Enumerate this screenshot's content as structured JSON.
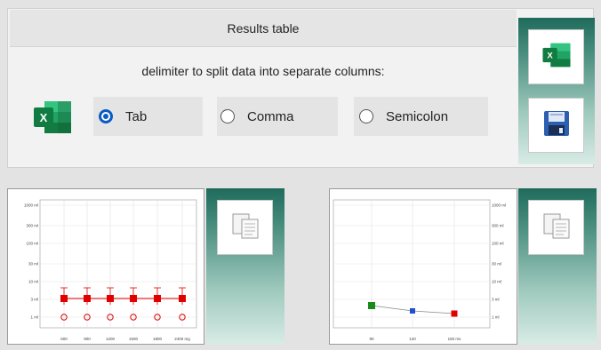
{
  "header": {
    "title": "Results table"
  },
  "delimiter": {
    "prompt": "delimiter to split data into separate columns:",
    "options": [
      {
        "label": "Tab",
        "selected": true
      },
      {
        "label": "Comma",
        "selected": false
      },
      {
        "label": "Semicolon",
        "selected": false
      }
    ]
  },
  "colors": {
    "accent": "#0a5bc4",
    "excel_green": "#1d7044",
    "sidebar_dark": "#1f6b5c",
    "sidebar_light": "#d8ece6",
    "series_red": "#e00000",
    "series_green": "#1a8a1a",
    "series_blue": "#1f4fd0"
  },
  "icons": {
    "excel": "excel-icon",
    "save": "floppy-disk-icon",
    "copy": "copy-icon"
  },
  "chart_left": {
    "y_ticks": [
      "1000 ml",
      "300 ml",
      "100 ml",
      "30 ml",
      "10 ml",
      "3 ml",
      "1 ml"
    ],
    "x_ticks": [
      "600",
      "900",
      "1200",
      "1500",
      "1800",
      "2400 mg"
    ]
  },
  "chart_right": {
    "y_ticks": [
      "1000 ml",
      "300 ml",
      "100 ml",
      "30 ml",
      "10 ml",
      "3 ml",
      "1 ml"
    ],
    "x_ticks": [
      "90",
      "120",
      "150 ms"
    ]
  }
}
